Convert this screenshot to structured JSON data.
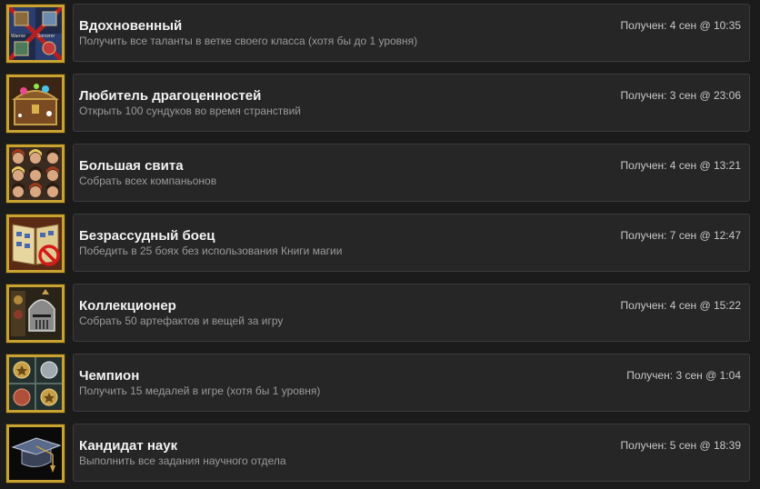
{
  "achievements": [
    {
      "title": "Вдохновенный",
      "description": "Получить все таланты в ветке своего класса (хотя бы до 1 уровня)",
      "unlocked": "Получен: 4 сен @ 10:35",
      "icon": "talents-grid-icon",
      "icon_words": [
        "Warrior",
        "Sorcerer"
      ]
    },
    {
      "title": "Любитель драгоценностей",
      "description": "Открыть 100 сундуков во время странствий",
      "unlocked": "Получен: 3 сен @ 23:06",
      "icon": "treasure-chest-icon"
    },
    {
      "title": "Большая свита",
      "description": "Собрать всех компаньонов",
      "unlocked": "Получен: 4 сен @ 13:21",
      "icon": "companions-portraits-icon"
    },
    {
      "title": "Безрассудный боец",
      "description": "Победить в 25 боях без использования Книги магии",
      "unlocked": "Получен: 7 сен @ 12:47",
      "icon": "no-spellbook-icon"
    },
    {
      "title": "Коллекционер",
      "description": "Собрать 50 артефактов и вещей за игру",
      "unlocked": "Получен: 4 сен @ 15:22",
      "icon": "knight-helmet-icon"
    },
    {
      "title": "Чемпион",
      "description": "Получить 15 медалей в игре (хотя бы 1 уровня)",
      "unlocked": "Получен: 3 сен @ 1:04",
      "icon": "medals-grid-icon"
    },
    {
      "title": "Кандидат наук",
      "description": "Выполнить все задания научного отдела",
      "unlocked": "Получен: 5 сен @ 18:39",
      "icon": "graduation-cap-icon"
    }
  ]
}
